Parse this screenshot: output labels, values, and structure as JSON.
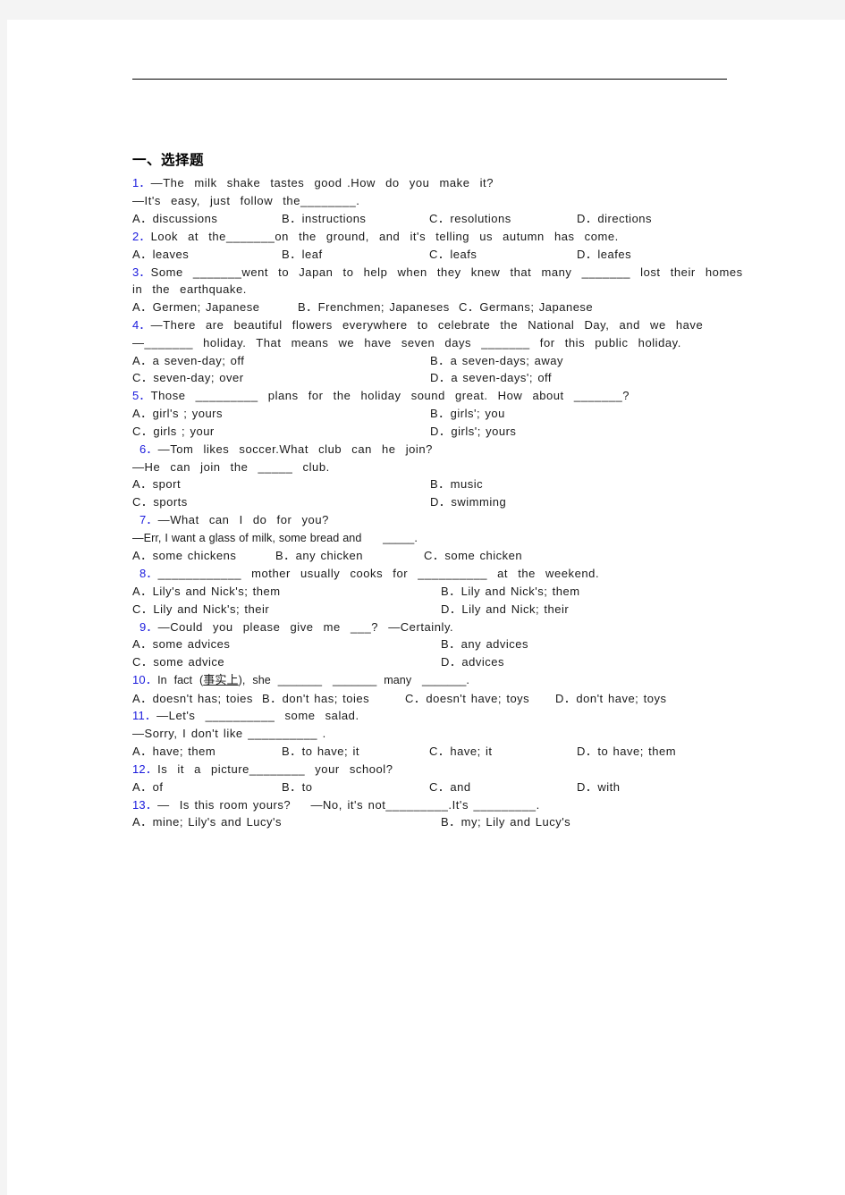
{
  "document": {
    "section_title": "一、选择题"
  },
  "questions": [
    {
      "num": "1．",
      "lines": [
        "—The  milk  shake  tastes  good .How  do  you  make  it?",
        "—It's  easy,  just  follow  the________."
      ],
      "option_layout": "cols4",
      "options": [
        "A．discussions",
        "B．instructions",
        "C．resolutions",
        "D．directions"
      ]
    },
    {
      "num": "2．",
      "lines": [
        "Look  at  the_______on  the  ground,  and  it's  telling  us  autumn  has  come."
      ],
      "option_layout": "cols4",
      "options": [
        "A．leaves",
        "B．leaf",
        "C．leafs",
        "D．leafes"
      ]
    },
    {
      "num": "3．",
      "lines": [
        "Some  _______went  to  Japan  to  help  when  they  knew  that  many  _______  lost  their  homes",
        "in  the  earthquake."
      ],
      "option_layout": "cols3",
      "options": [
        "A．Germen; Japanese",
        "B．Frenchmen; Japaneses",
        "C．Germans; Japanese"
      ]
    },
    {
      "num": "4．",
      "lines": [
        "—There  are  beautiful  flowers  everywhere  to  celebrate  the  National  Day,  and  we  have",
        "—_______  holiday.  That  means  we  have  seven  days  _______  for  this  public  holiday."
      ],
      "option_layout": "cols2",
      "options": [
        "A．a seven-day; off",
        "B．a seven-days; away",
        "C．seven-day; over",
        "D．a seven-days'; off"
      ]
    },
    {
      "num": "5．",
      "lines": [
        "Those  _________  plans  for  the  holiday  sound  great.  How  about  _______?"
      ],
      "option_layout": "cols2",
      "options": [
        "A．girl's ; yours",
        "B．girls'; you",
        "C．girls ; your",
        "D．girls'; yours"
      ]
    },
    {
      "num": "6．",
      "indent": true,
      "lines": [
        "—Tom  likes  soccer.What  club  can  he  join?",
        "—He  can  join  the  _____  club."
      ],
      "option_layout": "cols2",
      "options": [
        "A．sport",
        "B．music",
        "C．sports",
        "D．swimming"
      ]
    },
    {
      "num": "7．",
      "indent": true,
      "lines": [
        "—What  can  I  do  for  you?"
      ],
      "tight_lines": [
        "—Err, I want a glass of milk, some bread and      _____."
      ],
      "option_layout": "cols3b",
      "options": [
        "A．some chickens",
        "B．any chicken",
        "C．some chicken"
      ]
    },
    {
      "num": "8．",
      "indent": true,
      "lines": [
        "____________  mother  usually  cooks  for  __________  at  the  weekend."
      ],
      "option_layout": "cols2w",
      "options": [
        "A．Lily's and Nick's; them",
        "B．Lily and Nick's; them",
        "C．Lily and Nick's; their",
        "D．Lily and Nick; their"
      ]
    },
    {
      "num": "9．",
      "indent": true,
      "lines": [
        "—Could  you  please  give  me  ___?  —Certainly."
      ],
      "option_layout": "cols2w",
      "options": [
        "A．some advices",
        "B．any advices",
        "C．some advice",
        "D．advices"
      ]
    },
    {
      "num": "10．",
      "prefix": "In  fact  (",
      "cn": "事实上",
      "suffix": "),  she  _______   _______  many   _______.",
      "option_layout": "cols4n",
      "options": [
        "A．doesn't has; toies",
        "B．don't has; toies",
        "C．doesn't have; toys",
        "D．don't have; toys"
      ]
    },
    {
      "num": "11．",
      "lines": [
        "—Let's  __________  some  salad.",
        "—Sorry, I don't like __________ ."
      ],
      "option_layout": "cols4",
      "options": [
        "A．have; them",
        "B．to have; it",
        "C．have; it",
        "D．to have; them"
      ]
    },
    {
      "num": "12．",
      "lines": [
        "Is  it  a  picture________  your  school?"
      ],
      "option_layout": "cols4",
      "options": [
        "A．of",
        "B．to",
        "C．and",
        "D．with"
      ]
    },
    {
      "num": "13．",
      "lines": [
        "—  Is this room yours?    —No, it's not_________.It's _________."
      ],
      "option_layout": "cols2w",
      "options": [
        "A．mine; Lily's and Lucy's",
        "B．my; Lily and Lucy's"
      ]
    }
  ],
  "colors": {
    "question_number": "#1b1bdd",
    "body_text": "#1a1a1a",
    "page_background": "#ffffff",
    "canvas_background": "#f4f4f4",
    "rule": "#000000"
  }
}
